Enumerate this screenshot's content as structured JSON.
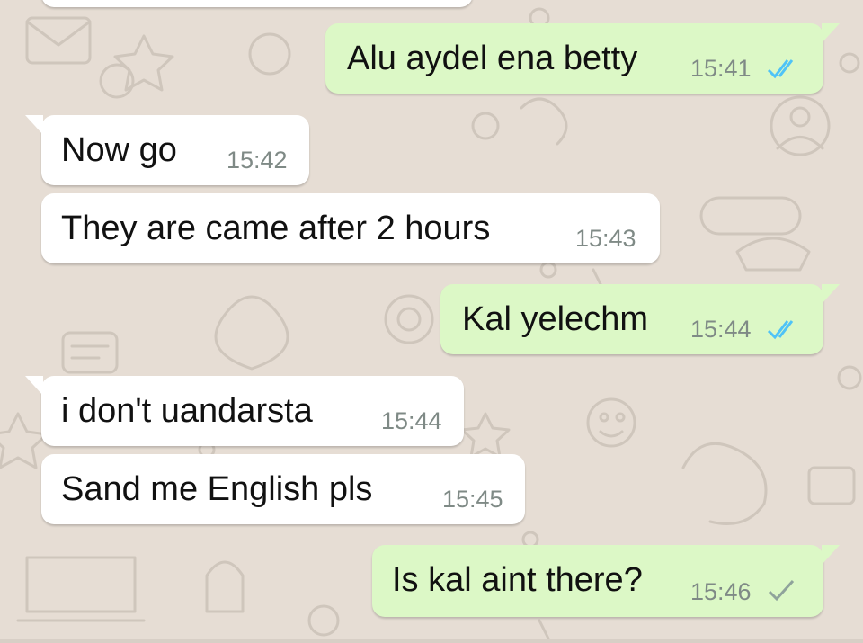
{
  "colors": {
    "background": "#e6ddd4",
    "incoming_bubble": "#ffffff",
    "outgoing_bubble": "#dcf8c6",
    "read_ticks": "#4fc3f7",
    "sent_tick": "#8fa39b",
    "timestamp": "#7f8a86"
  },
  "messages": [
    {
      "direction": "outgoing",
      "text": "Alu aydel ena betty",
      "time": "15:41",
      "status": "read",
      "status_icon": "double-check-icon"
    },
    {
      "direction": "incoming",
      "text": "Now go",
      "time": "15:42"
    },
    {
      "direction": "incoming",
      "text": "They are came after 2 hours",
      "time": "15:43"
    },
    {
      "direction": "outgoing",
      "text": "Kal yelechm",
      "time": "15:44",
      "status": "read",
      "status_icon": "double-check-icon"
    },
    {
      "direction": "incoming",
      "text": "i don't uandarsta",
      "time": "15:44"
    },
    {
      "direction": "incoming",
      "text": "Sand me English pls",
      "time": "15:45"
    },
    {
      "direction": "outgoing",
      "text": "Is kal aint there?",
      "time": "15:46",
      "status": "sent",
      "status_icon": "single-check-icon"
    }
  ]
}
